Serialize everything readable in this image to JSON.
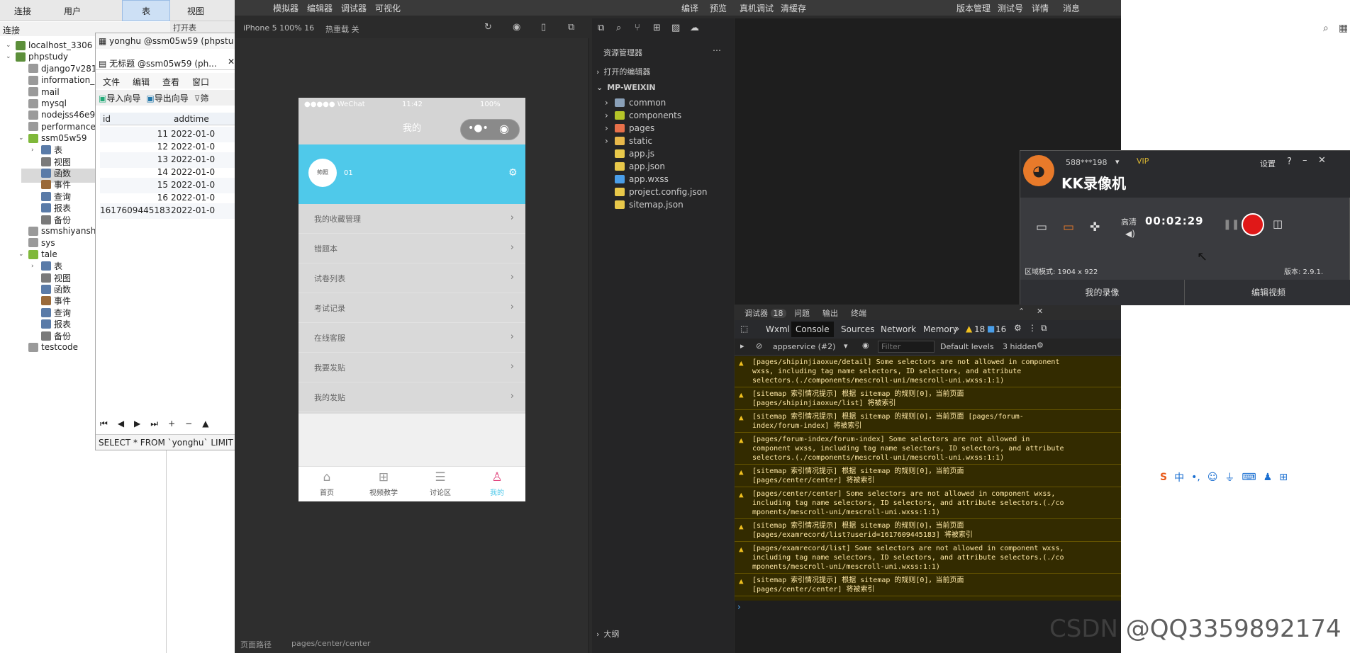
{
  "navicat": {
    "menu": [
      "连接",
      "用户",
      "表",
      "视图"
    ],
    "conn_label": "连接",
    "tree": [
      {
        "label": "localhost_3306",
        "level": 0,
        "icon": "db-conn"
      },
      {
        "label": "phpstudy",
        "level": 0,
        "icon": "db-conn"
      },
      {
        "label": "django7v281",
        "level": 1,
        "icon": "database"
      },
      {
        "label": "information_",
        "level": 1,
        "icon": "database"
      },
      {
        "label": "mail",
        "level": 1,
        "icon": "database"
      },
      {
        "label": "mysql",
        "level": 1,
        "icon": "database"
      },
      {
        "label": "nodejss46e9",
        "level": 1,
        "icon": "database"
      },
      {
        "label": "performance",
        "level": 1,
        "icon": "database"
      },
      {
        "label": "ssm05w59",
        "level": 1,
        "icon": "database-open"
      },
      {
        "label": "表",
        "level": 2,
        "icon": "table"
      },
      {
        "label": "视图",
        "level": 2,
        "icon": "view"
      },
      {
        "label": "函数",
        "level": 2,
        "icon": "function"
      },
      {
        "label": "事件",
        "level": 2,
        "icon": "event"
      },
      {
        "label": "查询",
        "level": 2,
        "icon": "query"
      },
      {
        "label": "报表",
        "level": 2,
        "icon": "report"
      },
      {
        "label": "备份",
        "level": 2,
        "icon": "backup"
      },
      {
        "label": "ssmshiyanshi",
        "level": 1,
        "icon": "database"
      },
      {
        "label": "sys",
        "level": 1,
        "icon": "database"
      },
      {
        "label": "tale",
        "level": 1,
        "icon": "database-open"
      },
      {
        "label": "表",
        "level": 2,
        "icon": "table"
      },
      {
        "label": "视图",
        "level": 2,
        "icon": "view"
      },
      {
        "label": "函数",
        "level": 2,
        "icon": "function"
      },
      {
        "label": "事件",
        "level": 2,
        "icon": "event"
      },
      {
        "label": "查询",
        "level": 2,
        "icon": "query"
      },
      {
        "label": "报表",
        "level": 2,
        "icon": "report"
      },
      {
        "label": "备份",
        "level": 2,
        "icon": "backup"
      },
      {
        "label": "testcode",
        "level": 1,
        "icon": "database"
      }
    ],
    "tab1": "yonghu @ssm05w59 (phpstu",
    "tab2": "无标题 @ssm05w59 (ph...",
    "open_table": "打开表",
    "editor_menu": [
      "文件",
      "编辑",
      "查看",
      "窗口"
    ],
    "toolbar": [
      "导入向导",
      "导出向导",
      "筛"
    ],
    "grid": {
      "columns": [
        "id",
        "addtime"
      ],
      "rows": [
        [
          "11",
          "2022-01-0"
        ],
        [
          "12",
          "2022-01-0"
        ],
        [
          "13",
          "2022-01-0"
        ],
        [
          "14",
          "2022-01-0"
        ],
        [
          "15",
          "2022-01-0"
        ],
        [
          "16",
          "2022-01-0"
        ],
        [
          "1617609445183",
          "2022-01-0"
        ]
      ]
    },
    "sql": "SELECT * FROM `yonghu` LIMIT 0"
  },
  "wx": {
    "menu": [
      "模拟器",
      "编辑器",
      "调试器",
      "可视化"
    ],
    "menu_right": [
      "编译",
      "预览",
      "真机调试",
      "清缓存"
    ],
    "menu_far": [
      "版本管理",
      "测试号",
      "详情",
      "消息"
    ],
    "device": "iPhone 5 100% 16",
    "hotreload": "热重载 关",
    "phone": {
      "carrier": "●●●●● WeChat",
      "time": "11:42",
      "battery": "100%",
      "nav_title": "我的",
      "avatar_text": "帅照",
      "username": "01",
      "items": [
        "我的收藏管理",
        "错题本",
        "试卷列表",
        "考试记录",
        "在线客服",
        "我要发贴",
        "我的发贴"
      ],
      "tabs": [
        "首页",
        "视频教学",
        "讨论区",
        "我的"
      ]
    },
    "explorer": {
      "title": "资源管理器",
      "open_editors": "打开的编辑器",
      "project": "MP-WEIXIN",
      "files": [
        {
          "name": "common",
          "type": "folder",
          "color": "#8aa0b8"
        },
        {
          "name": "components",
          "type": "folder",
          "color": "#b5c428"
        },
        {
          "name": "pages",
          "type": "folder",
          "color": "#e8704a"
        },
        {
          "name": "static",
          "type": "folder",
          "color": "#e8b84a"
        },
        {
          "name": "app.js",
          "type": "js",
          "color": "#e8c84a"
        },
        {
          "name": "app.json",
          "type": "json",
          "color": "#e8c84a"
        },
        {
          "name": "app.wxss",
          "type": "wxss",
          "color": "#4a9ee8"
        },
        {
          "name": "project.config.json",
          "type": "json",
          "color": "#e8c84a"
        },
        {
          "name": "sitemap.json",
          "type": "json",
          "color": "#e8c84a"
        }
      ],
      "outline": "大纲"
    },
    "debug": {
      "tabs": [
        "调试器",
        "问题",
        "输出",
        "终端"
      ],
      "debug_count": "18",
      "tabs2": [
        "Wxml",
        "Console",
        "Sources",
        "Network",
        "Memory"
      ],
      "warn_count": "18",
      "info_count": "16",
      "context": "appservice (#2)",
      "filter_placeholder": "Filter",
      "levels": "Default levels",
      "hidden": "3 hidden",
      "messages": [
        "[pages/shipinjiaoxue/detail] Some selectors are not allowed in component\nwxss, including tag name selectors, ID selectors, and attribute\nselectors.(./components/mescroll-uni/mescroll-uni.wxss:1:1)",
        "[sitemap 索引情况提示] 根据 sitemap 的规则[0]，当前页面\n[pages/shipinjiaoxue/list] 将被索引",
        "[sitemap 索引情况提示] 根据 sitemap 的规则[0]，当前页面 [pages/forum-\nindex/forum-index] 将被索引",
        "[pages/forum-index/forum-index] Some selectors are not allowed in\ncomponent wxss, including tag name selectors, ID selectors, and attribute\nselectors.(./components/mescroll-uni/mescroll-uni.wxss:1:1)",
        "[sitemap 索引情况提示] 根据 sitemap 的规则[0]，当前页面\n[pages/center/center] 将被索引",
        "[pages/center/center] Some selectors are not allowed in component wxss,\nincluding tag name selectors, ID selectors, and attribute selectors.(./co\nmponents/mescroll-uni/mescroll-uni.wxss:1:1)",
        "[sitemap 索引情况提示] 根据 sitemap 的规则[0]，当前页面\n[pages/examrecord/list?userid=1617609445183] 将被索引",
        "[pages/examrecord/list] Some selectors are not allowed in component wxss,\nincluding tag name selectors, ID selectors, and attribute selectors.(./co\nmponents/mescroll-uni/mescroll-uni.wxss:1:1)",
        "[sitemap 索引情况提示] 根据 sitemap 的规则[0]，当前页面\n[pages/center/center] 将被索引"
      ]
    },
    "path_label": "页面路径",
    "path": "pages/center/center"
  },
  "kk": {
    "user": "588***198",
    "vip": "VIP",
    "settings": "设置",
    "title": "KK录像机",
    "quality": "高清",
    "timer": "00:02:29",
    "region": "区域模式: 1904 x 922",
    "version": "版本: 2.9.1.",
    "btn_my": "我的录像",
    "btn_edit": "编辑视频"
  },
  "watermark": "CSDN @QQ3359892174",
  "ime_label": "中"
}
